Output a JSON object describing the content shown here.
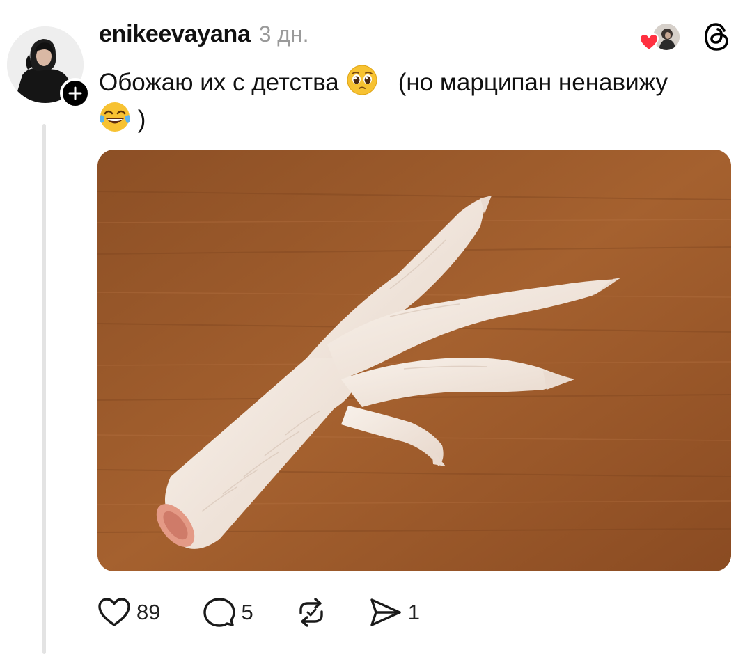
{
  "post": {
    "username": "enikeevayana",
    "time": "3 дн.",
    "text_part1": "Обожаю их с детства",
    "text_part2": "(но марципан ненавижу",
    "text_close": ")"
  },
  "icons": {
    "avatar": "profile-photo",
    "follow": "plus-icon",
    "liked_by": "heart-icon",
    "app_logo": "threads-logo-icon",
    "emoji_1": "pleading-face-emoji",
    "emoji_2": "face-with-tears-of-joy-emoji",
    "like": "heart-outline-icon",
    "reply": "comment-bubble-icon",
    "repost": "repost-icon",
    "share": "send-icon"
  },
  "actions": {
    "likes": "89",
    "replies": "5",
    "shares": "1"
  },
  "colors": {
    "accent_heart": "#ff3040",
    "thread_line": "#e3e3e3",
    "muted_text": "#9a9a9a",
    "board_wood": "#9d5a2c"
  }
}
